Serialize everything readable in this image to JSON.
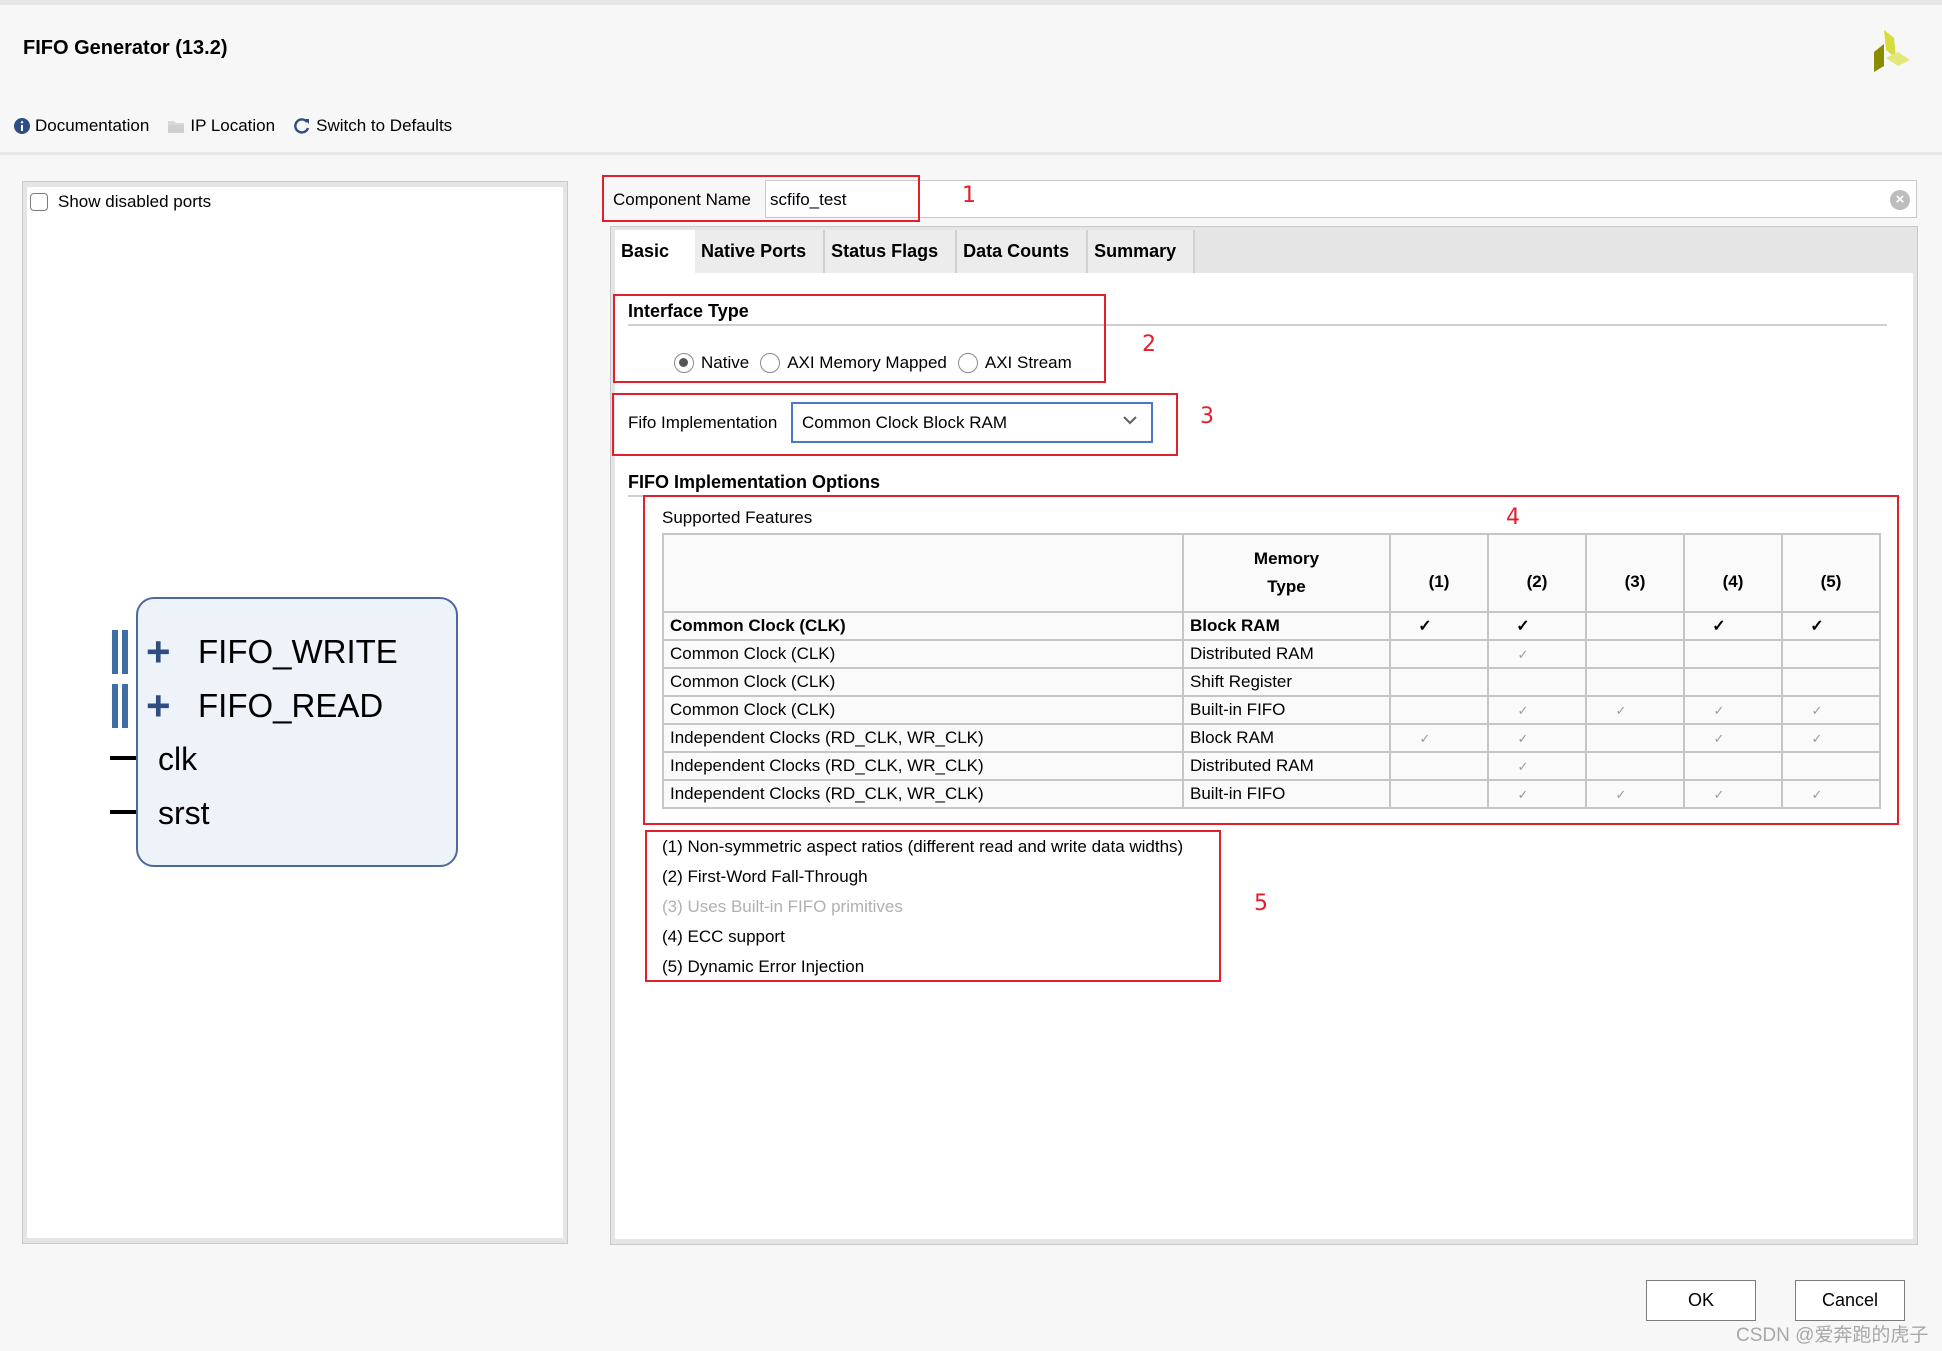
{
  "window": {
    "title": "FIFO Generator (13.2)"
  },
  "toolbar": {
    "items": [
      {
        "label": "Documentation",
        "icon": "info-icon"
      },
      {
        "label": "IP Location",
        "icon": "folder-icon"
      },
      {
        "label": "Switch to Defaults",
        "icon": "refresh-icon"
      }
    ]
  },
  "left_panel": {
    "show_disabled_ports": {
      "label": "Show disabled ports",
      "checked": false
    },
    "block": {
      "bus_ports": [
        "FIFO_WRITE",
        "FIFO_READ"
      ],
      "ports": [
        "clk",
        "srst"
      ]
    }
  },
  "component_name": {
    "label": "Component Name",
    "value": "scfifo_test"
  },
  "tabs": [
    {
      "label": "Basic",
      "active": true
    },
    {
      "label": "Native Ports",
      "active": false
    },
    {
      "label": "Status Flags",
      "active": false
    },
    {
      "label": "Data Counts",
      "active": false
    },
    {
      "label": "Summary",
      "active": false
    }
  ],
  "interface_type": {
    "title": "Interface Type",
    "options": [
      {
        "label": "Native",
        "selected": true
      },
      {
        "label": "AXI Memory Mapped",
        "selected": false
      },
      {
        "label": "AXI Stream",
        "selected": false
      }
    ]
  },
  "fifo_implementation": {
    "label": "Fifo Implementation",
    "value": "Common Clock Block RAM"
  },
  "implementation_options": {
    "title": "FIFO Implementation Options",
    "supported_features_label": "Supported Features",
    "table": {
      "headers": [
        "",
        "Memory Type",
        "(1)",
        "(2)",
        "(3)",
        "(4)",
        "(5)"
      ],
      "rows": [
        {
          "clock": "Common Clock (CLK)",
          "memory": "Block RAM",
          "selected": true,
          "checks": [
            true,
            true,
            false,
            true,
            true
          ]
        },
        {
          "clock": "Common Clock (CLK)",
          "memory": "Distributed RAM",
          "selected": false,
          "checks": [
            false,
            true,
            false,
            false,
            false
          ]
        },
        {
          "clock": "Common Clock (CLK)",
          "memory": "Shift Register",
          "selected": false,
          "checks": [
            false,
            false,
            false,
            false,
            false
          ]
        },
        {
          "clock": "Common Clock (CLK)",
          "memory": "Built-in FIFO",
          "selected": false,
          "checks": [
            false,
            true,
            true,
            true,
            true
          ]
        },
        {
          "clock": "Independent Clocks (RD_CLK, WR_CLK)",
          "memory": "Block RAM",
          "selected": false,
          "checks": [
            true,
            true,
            false,
            true,
            true
          ]
        },
        {
          "clock": "Independent Clocks (RD_CLK, WR_CLK)",
          "memory": "Distributed RAM",
          "selected": false,
          "checks": [
            false,
            true,
            false,
            false,
            false
          ]
        },
        {
          "clock": "Independent Clocks (RD_CLK, WR_CLK)",
          "memory": "Built-in FIFO",
          "selected": false,
          "checks": [
            false,
            true,
            true,
            true,
            true
          ]
        }
      ]
    },
    "legend": [
      {
        "text": "(1) Non-symmetric aspect ratios (different read and write data widths)",
        "disabled": false
      },
      {
        "text": "(2) First-Word Fall-Through",
        "disabled": false
      },
      {
        "text": "(3) Uses Built-in FIFO primitives",
        "disabled": true
      },
      {
        "text": "(4) ECC support",
        "disabled": false
      },
      {
        "text": "(5) Dynamic Error Injection",
        "disabled": false
      }
    ]
  },
  "annotations": [
    "1",
    "2",
    "3",
    "4",
    "5"
  ],
  "buttons": {
    "ok": "OK",
    "cancel": "Cancel"
  },
  "watermark": "CSDN @爱奔跑的虎子",
  "colors": {
    "annotation_red": "#e2202c",
    "select_focus_blue": "#4a78c8",
    "block_border": "#4a6aa0"
  }
}
